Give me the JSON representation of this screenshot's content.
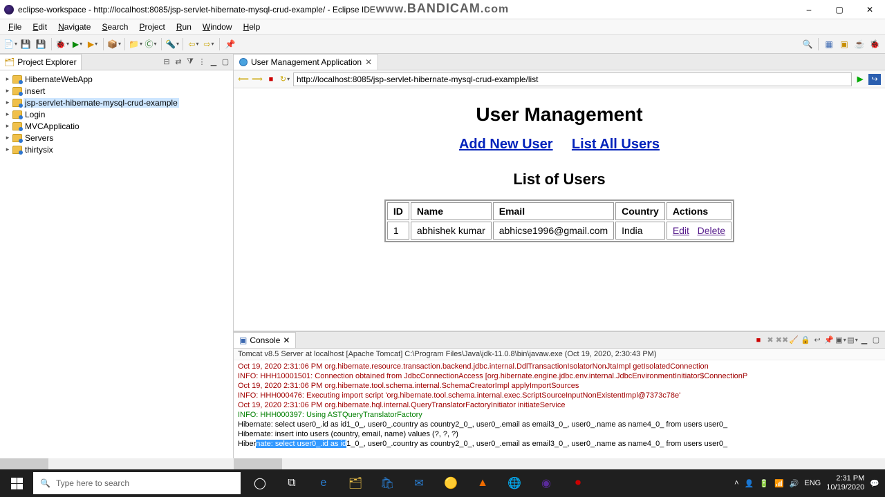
{
  "window": {
    "title": "eclipse-workspace - http://localhost:8085/jsp-servlet-hibernate-mysql-crud-example/ - Eclipse IDE",
    "min": "–",
    "max": "▢",
    "close": "✕"
  },
  "watermark_prefix": "www.",
  "watermark_main": "BANDICAM",
  "watermark_suffix": ".com",
  "menu": [
    "File",
    "Edit",
    "Navigate",
    "Search",
    "Project",
    "Run",
    "Window",
    "Help"
  ],
  "project_explorer": {
    "title": "Project Explorer",
    "items": [
      "HibernateWebApp",
      "insert",
      "jsp-servlet-hibernate-mysql-crud-example",
      "Login",
      "MVCApplicatio",
      "Servers",
      "thirtysix"
    ],
    "selected_index": 2
  },
  "editor": {
    "tab_title": "User Management Application",
    "url": "http://localhost:8085/jsp-servlet-hibernate-mysql-crud-example/list"
  },
  "page": {
    "heading": "User Management",
    "link_add": "Add New User",
    "link_list": "List All Users",
    "list_heading": "List of Users",
    "columns": [
      "ID",
      "Name",
      "Email",
      "Country",
      "Actions"
    ],
    "rows": [
      {
        "id": "1",
        "name": "abhishek kumar",
        "email": "abhicse1996@gmail.com",
        "country": "India",
        "edit": "Edit",
        "delete": "Delete"
      }
    ]
  },
  "console": {
    "title": "Console",
    "header": "Tomcat v8.5 Server at localhost [Apache Tomcat] C:\\Program Files\\Java\\jdk-11.0.8\\bin\\javaw.exe (Oct 19, 2020, 2:30:43 PM)",
    "lines": [
      {
        "cls": "log-red",
        "text": "Oct 19, 2020 2:31:06 PM org.hibernate.resource.transaction.backend.jdbc.internal.DdlTransactionIsolatorNonJtaImpl getIsolatedConnection"
      },
      {
        "cls": "log-red",
        "text": "INFO: HHH10001501: Connection obtained from JdbcConnectionAccess [org.hibernate.engine.jdbc.env.internal.JdbcEnvironmentInitiator$ConnectionP"
      },
      {
        "cls": "log-red",
        "text": "Oct 19, 2020 2:31:06 PM org.hibernate.tool.schema.internal.SchemaCreatorImpl applyImportSources"
      },
      {
        "cls": "log-red",
        "text": "INFO: HHH000476: Executing import script 'org.hibernate.tool.schema.internal.exec.ScriptSourceInputNonExistentImpl@7373c78e'"
      },
      {
        "cls": "log-red",
        "text": "Oct 19, 2020 2:31:06 PM org.hibernate.hql.internal.QueryTranslatorFactoryInitiator initiateService"
      },
      {
        "cls": "log-green",
        "text": "INFO: HHH000397: Using ASTQueryTranslatorFactory"
      },
      {
        "cls": "log-black",
        "text": "Hibernate: select user0_.id as id1_0_, user0_.country as country2_0_, user0_.email as email3_0_, user0_.name as name4_0_ from users user0_"
      },
      {
        "cls": "log-black",
        "text": "Hibernate: insert into users (country, email, name) values (?, ?, ?)"
      },
      {
        "cls": "log-black",
        "text": "Hibernate: select user0_.id as id1_0_, user0_.country as country2_0_, user0_.email as email3_0_, user0_.name as name4_0_ from users user0_",
        "sel_start": 5,
        "sel_end": 33
      }
    ]
  },
  "taskbar": {
    "search_placeholder": "Type here to search",
    "time": "2:31 PM",
    "date": "10/19/2020"
  }
}
